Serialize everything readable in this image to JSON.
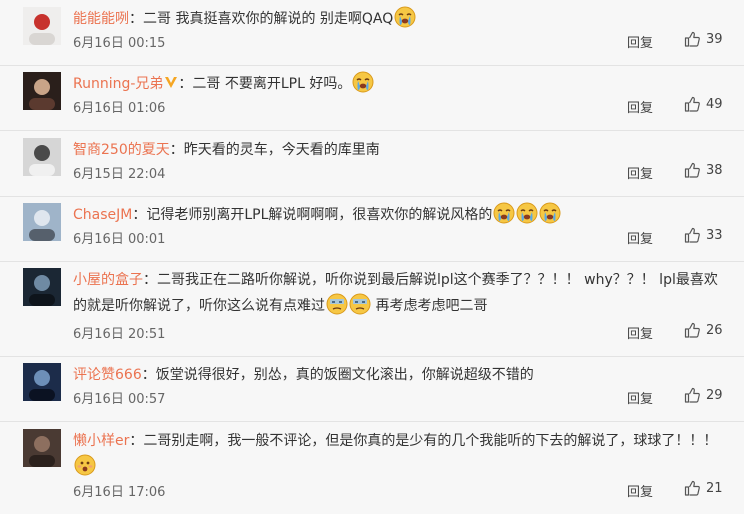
{
  "comments": [
    {
      "author": "能能能咧",
      "sep": "：",
      "text": "二哥 我真挺喜欢你的解说的 别走啊QAQ",
      "emojis": 1,
      "emoji_type": "cry",
      "date": "6月16日 00:15",
      "reply": "回复",
      "likes": "39",
      "avatar_colors": [
        "#efeeed",
        "#c7322d",
        "#d9d6d3"
      ]
    },
    {
      "author": "Running-兄弟",
      "sep": "：",
      "text": "二哥 不要离开LPL 好吗。",
      "emojis": 1,
      "emoji_type": "cry",
      "date": "6月16日 01:06",
      "reply": "回复",
      "likes": "49",
      "avatar_colors": [
        "#2a1f1b",
        "#c9a488",
        "#5b3a2f"
      ]
    },
    {
      "author": "智商250的夏天",
      "sep": "：",
      "text": "昨天看的灵车，今天看的库里南",
      "emojis": 0,
      "date": "6月15日 22:04",
      "reply": "回复",
      "likes": "38",
      "avatar_colors": [
        "#d6d6d6",
        "#4a4a4a",
        "#f0f0f0"
      ]
    },
    {
      "author": "ChaseJM",
      "sep": "：",
      "text": "记得老师别离开LPL解说啊啊啊，很喜欢你的解说风格的",
      "emojis": 3,
      "emoji_type": "cry",
      "date": "6月16日 00:01",
      "reply": "回复",
      "likes": "33",
      "avatar_colors": [
        "#9fb4c9",
        "#dfe6ee",
        "#56606c"
      ]
    },
    {
      "author": "小屋的盒子",
      "sep": "：",
      "text": "二哥我正在二路听你解说，听你说到最后解说lpl这个赛季了？？！！ why？？！ lpl最喜欢的就是听你解说了，听你这么说有点难过",
      "text_after": " 再考虑考虑吧二哥",
      "emojis": 2,
      "emoji_type": "sweat",
      "date": "6月16日 20:51",
      "reply": "回复",
      "likes": "26",
      "avatar_colors": [
        "#1b2734",
        "#6f8aa3",
        "#0e141b"
      ]
    },
    {
      "author": "评论赞666",
      "sep": "：",
      "text": "饭堂说得很好，别怂，真的饭圈文化滚出，你解说超级不错的",
      "emojis": 0,
      "date": "6月16日 00:57",
      "reply": "回复",
      "likes": "29",
      "avatar_colors": [
        "#1c2c4a",
        "#6d8fb8",
        "#0b1222"
      ]
    },
    {
      "author": "懒小样er",
      "sep": "：",
      "text": "二哥别走啊，我一般不评论，但是你真的是少有的几个我能听的下去的解说了，球球了！！！",
      "emojis": 1,
      "emoji_type": "shock",
      "date": "6月16日 17:06",
      "reply": "回复",
      "likes": "21",
      "avatar_colors": [
        "#4a3a33",
        "#8d6f5f",
        "#2b211d"
      ]
    }
  ],
  "colors": {
    "author": "#eb7350",
    "text": "#333333",
    "meta": "#666666",
    "divider": "#e3e3e3",
    "background": "#f7f7f7"
  }
}
